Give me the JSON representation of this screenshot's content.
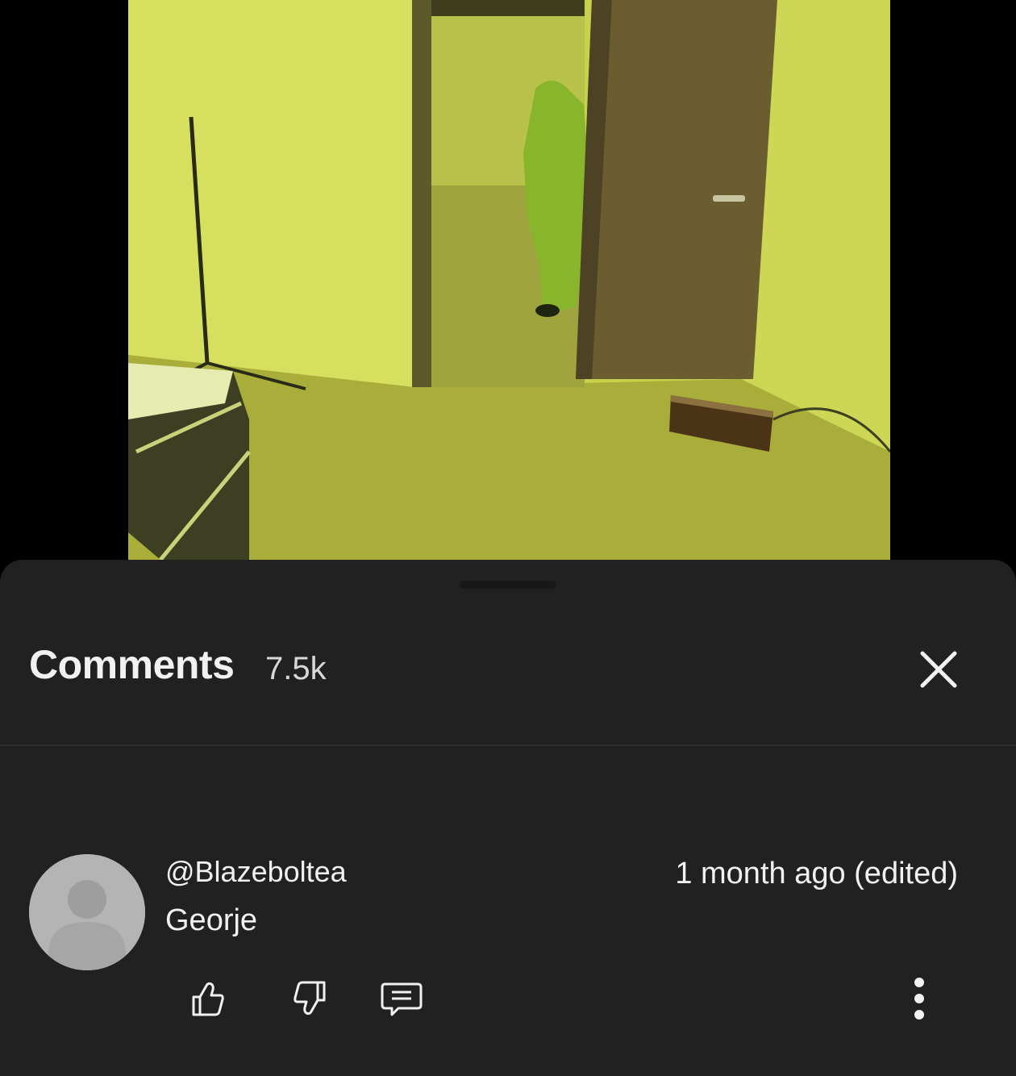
{
  "comments_panel": {
    "title": "Comments",
    "count": "7.5k",
    "close_icon": "close-icon"
  },
  "comment": {
    "author": "@Blazeboltea",
    "text": "Georje",
    "time": "1 month ago (edited)",
    "avatar_icon": "default-avatar-icon",
    "actions": {
      "like_icon": "thumbs-up-icon",
      "dislike_icon": "thumbs-down-icon",
      "reply_icon": "reply-comment-icon",
      "more_icon": "more-vertical-icon"
    }
  },
  "colors": {
    "sheet_bg": "#212121",
    "text_primary": "#f1f1f1",
    "avatar_bg": "#b4b4b4",
    "video_tint": "#c9d247"
  }
}
